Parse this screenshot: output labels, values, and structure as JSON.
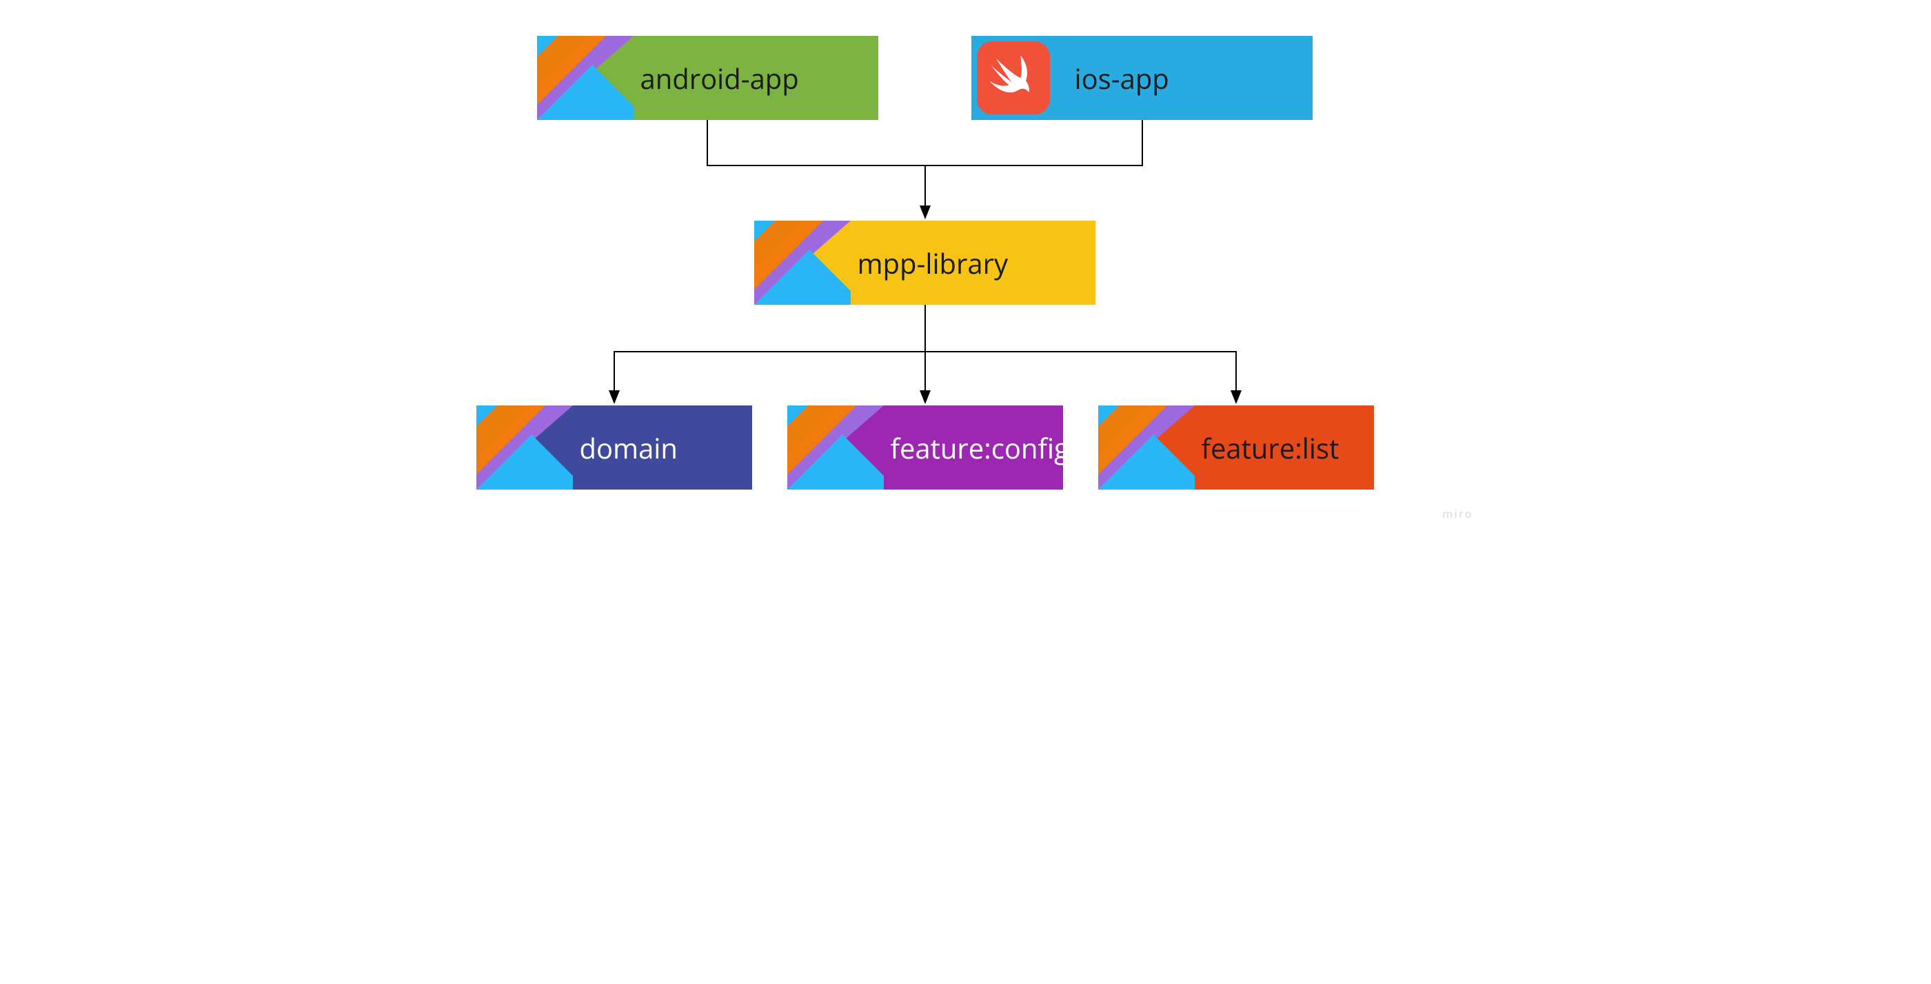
{
  "diagram": {
    "nodes": {
      "android_app": {
        "label": "android-app",
        "color": "#7CB342",
        "text_color": "dark",
        "logo": "kotlin"
      },
      "ios_app": {
        "label": "ios-app",
        "color": "#29ABE2",
        "text_color": "dark",
        "logo": "swift"
      },
      "mpp_library": {
        "label": "mpp-library",
        "color": "#F7C416",
        "text_color": "dark",
        "logo": "kotlin"
      },
      "domain": {
        "label": "domain",
        "color": "#3F4A9C",
        "text_color": "light",
        "logo": "kotlin"
      },
      "feature_config": {
        "label": "feature:config",
        "color": "#9C27B0",
        "text_color": "light",
        "logo": "kotlin"
      },
      "feature_list": {
        "label": "feature:list",
        "color": "#E64A19",
        "text_color": "dark",
        "logo": "kotlin"
      }
    },
    "edges": [
      {
        "from": "android_app",
        "to": "mpp_library"
      },
      {
        "from": "ios_app",
        "to": "mpp_library"
      },
      {
        "from": "mpp_library",
        "to": "domain"
      },
      {
        "from": "mpp_library",
        "to": "feature_config"
      },
      {
        "from": "mpp_library",
        "to": "feature_list"
      }
    ]
  },
  "watermark": "miro"
}
